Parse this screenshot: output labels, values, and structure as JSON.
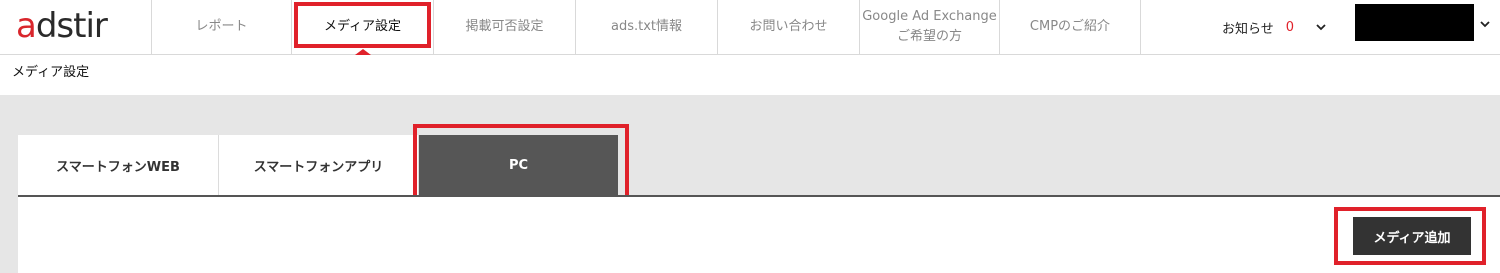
{
  "logo": {
    "text_prefix": "a",
    "text_rest": "dstir"
  },
  "nav": {
    "items": [
      {
        "label": "レポート",
        "width": 140
      },
      {
        "label": "メディア設定",
        "width": 142
      },
      {
        "label": "掲載可否設定",
        "width": 142
      },
      {
        "label": "ads.txt情報",
        "width": 142
      },
      {
        "label": "お問い合わせ",
        "width": 142
      },
      {
        "label": "Google Ad Exchange\nご希望の方",
        "width": 140
      },
      {
        "label": "CMPのご紹介",
        "width": 142
      }
    ],
    "notifications_label": "お知らせ",
    "notifications_count": "0"
  },
  "breadcrumb": {
    "current": "メディア設定"
  },
  "tabs": [
    {
      "label": "スマートフォンWEB"
    },
    {
      "label": "スマートフォンアプリ"
    },
    {
      "label": "PC"
    }
  ],
  "actions": {
    "add_media_label": "メディア追加"
  },
  "colors": {
    "accent": "#e0212a",
    "dark": "#333333",
    "tab_active": "#565656"
  }
}
